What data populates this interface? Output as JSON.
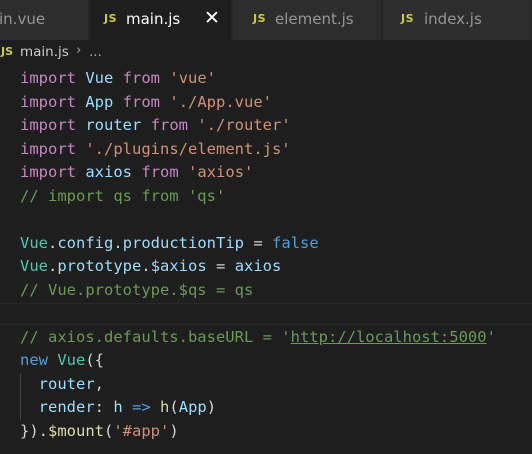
{
  "tabs": [
    {
      "label": "main.vue",
      "visible_text": "in.vue",
      "icon": null,
      "active": false
    },
    {
      "label": "main.js",
      "icon": "JS",
      "active": true,
      "close": "✕"
    },
    {
      "label": "element.js",
      "icon": "JS",
      "active": false
    },
    {
      "label": "index.js",
      "icon": "JS",
      "active": false
    }
  ],
  "breadcrumb": {
    "icon": "JS",
    "file": "main.js",
    "separator": "›",
    "more": "..."
  },
  "colors": {
    "background": "#1e1e1e",
    "keyword": "#c586c0",
    "variable": "#9cdcfe",
    "class": "#4ec9b0",
    "string": "#ce9178",
    "comment": "#6a9955",
    "boolean": "#569cd6",
    "function": "#dcdcaa",
    "js_icon": "#cbcb41"
  },
  "code": {
    "lines": [
      [
        {
          "t": "import",
          "k": "kw"
        },
        {
          "t": " ",
          "k": "op"
        },
        {
          "t": "Vue",
          "k": "id"
        },
        {
          "t": " ",
          "k": "op"
        },
        {
          "t": "from",
          "k": "kw"
        },
        {
          "t": " ",
          "k": "op"
        },
        {
          "t": "'vue'",
          "k": "str"
        }
      ],
      [
        {
          "t": "import",
          "k": "kw"
        },
        {
          "t": " ",
          "k": "op"
        },
        {
          "t": "App",
          "k": "id"
        },
        {
          "t": " ",
          "k": "op"
        },
        {
          "t": "from",
          "k": "kw"
        },
        {
          "t": " ",
          "k": "op"
        },
        {
          "t": "'./App.vue'",
          "k": "str"
        }
      ],
      [
        {
          "t": "import",
          "k": "kw"
        },
        {
          "t": " ",
          "k": "op"
        },
        {
          "t": "router",
          "k": "id"
        },
        {
          "t": " ",
          "k": "op"
        },
        {
          "t": "from",
          "k": "kw"
        },
        {
          "t": " ",
          "k": "op"
        },
        {
          "t": "'./router'",
          "k": "str"
        }
      ],
      [
        {
          "t": "import",
          "k": "kw"
        },
        {
          "t": " ",
          "k": "op"
        },
        {
          "t": "'./plugins/element.js'",
          "k": "str"
        }
      ],
      [
        {
          "t": "import",
          "k": "kw"
        },
        {
          "t": " ",
          "k": "op"
        },
        {
          "t": "axios",
          "k": "id"
        },
        {
          "t": " ",
          "k": "op"
        },
        {
          "t": "from",
          "k": "kw"
        },
        {
          "t": " ",
          "k": "op"
        },
        {
          "t": "'axios'",
          "k": "str"
        }
      ],
      [
        {
          "t": "// import qs from 'qs'",
          "k": "cmt"
        }
      ],
      [],
      [
        {
          "t": "Vue",
          "k": "cls"
        },
        {
          "t": ".",
          "k": "op"
        },
        {
          "t": "config",
          "k": "id"
        },
        {
          "t": ".",
          "k": "op"
        },
        {
          "t": "productionTip",
          "k": "id"
        },
        {
          "t": " = ",
          "k": "op"
        },
        {
          "t": "false",
          "k": "bool"
        }
      ],
      [
        {
          "t": "Vue",
          "k": "cls"
        },
        {
          "t": ".",
          "k": "op"
        },
        {
          "t": "prototype",
          "k": "id"
        },
        {
          "t": ".",
          "k": "op"
        },
        {
          "t": "$axios",
          "k": "id"
        },
        {
          "t": " = ",
          "k": "op"
        },
        {
          "t": "axios",
          "k": "id"
        }
      ],
      [
        {
          "t": "// Vue.prototype.$qs = qs",
          "k": "cmt"
        }
      ],
      [],
      [
        {
          "t": "// axios.defaults.baseURL = '",
          "k": "cmt"
        },
        {
          "t": "http://localhost:5000",
          "k": "cmt link"
        },
        {
          "t": "'",
          "k": "cmt"
        }
      ],
      [
        {
          "t": "new",
          "k": "bool"
        },
        {
          "t": " ",
          "k": "op"
        },
        {
          "t": "Vue",
          "k": "cls"
        },
        {
          "t": "({",
          "k": "op"
        }
      ],
      [
        {
          "t": "  ",
          "k": "op"
        },
        {
          "t": "router",
          "k": "id"
        },
        {
          "t": ",",
          "k": "op"
        }
      ],
      [
        {
          "t": "  ",
          "k": "op"
        },
        {
          "t": "render",
          "k": "id"
        },
        {
          "t": ": ",
          "k": "op"
        },
        {
          "t": "h",
          "k": "id"
        },
        {
          "t": " ",
          "k": "op"
        },
        {
          "t": "=>",
          "k": "bool"
        },
        {
          "t": " ",
          "k": "op"
        },
        {
          "t": "h",
          "k": "fn"
        },
        {
          "t": "(",
          "k": "op"
        },
        {
          "t": "App",
          "k": "id"
        },
        {
          "t": ")",
          "k": "op"
        }
      ],
      [
        {
          "t": "}).",
          "k": "op"
        },
        {
          "t": "$mount",
          "k": "fn"
        },
        {
          "t": "(",
          "k": "op"
        },
        {
          "t": "'#app'",
          "k": "str"
        },
        {
          "t": ")",
          "k": "op"
        }
      ]
    ],
    "current_line": 11
  }
}
